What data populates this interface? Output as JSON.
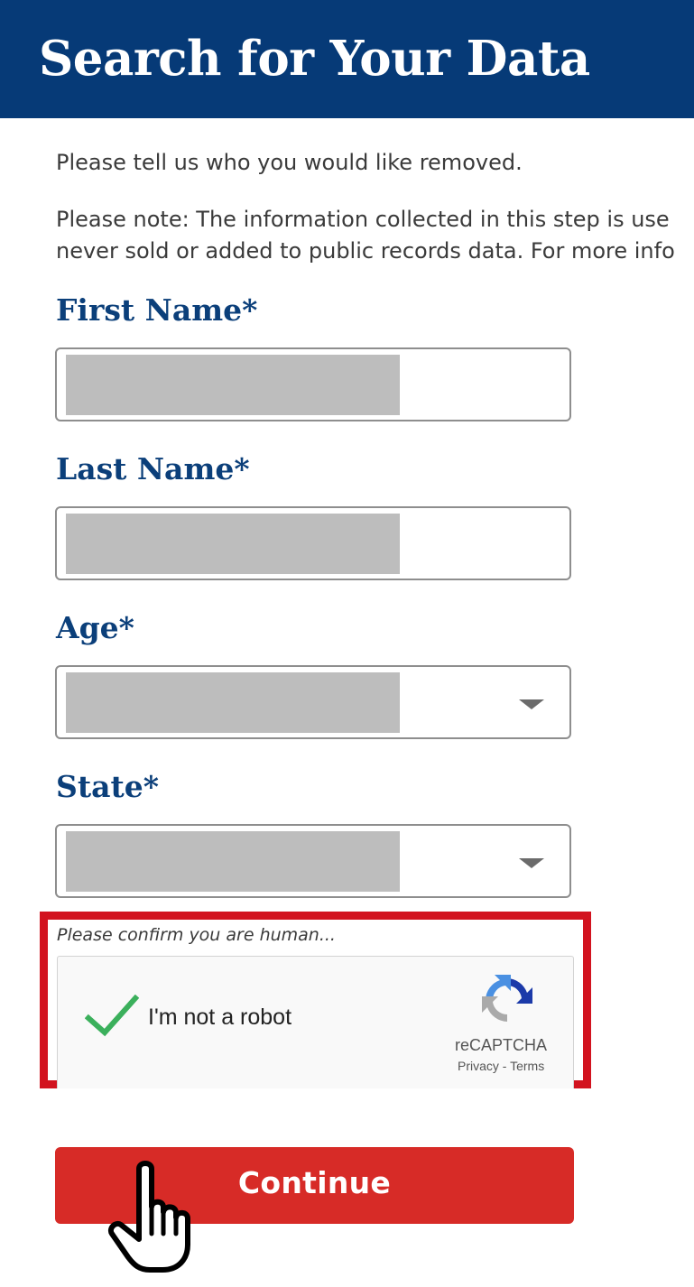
{
  "header": {
    "title": "Search for Your Data"
  },
  "intro": {
    "text": "Please tell us who you would like removed.",
    "note_line1": "Please note: The information collected in this step is use",
    "note_line2": "never sold or added to public records data. For more info"
  },
  "form": {
    "first_name": {
      "label": "First Name*",
      "value": ""
    },
    "last_name": {
      "label": "Last Name*",
      "value": ""
    },
    "age": {
      "label": "Age*",
      "selected": ""
    },
    "state": {
      "label": "State*",
      "selected": ""
    }
  },
  "captcha": {
    "prompt": "Please confirm you are human...",
    "checkbox_label": "I'm not a robot",
    "brand": "reCAPTCHA",
    "privacy": "Privacy",
    "separator": " - ",
    "terms": "Terms",
    "checked": true
  },
  "actions": {
    "continue_label": "Continue"
  },
  "colors": {
    "header_bg": "#063a77",
    "label": "#0b3f7a",
    "button_bg": "#d72b27",
    "highlight_border": "#d2131f",
    "check": "#3bb05c"
  },
  "icons": {
    "check": "checkmark-icon",
    "recaptcha": "recaptcha-logo-icon",
    "cursor": "hand-pointer-icon",
    "dropdown": "caret-down-icon"
  }
}
